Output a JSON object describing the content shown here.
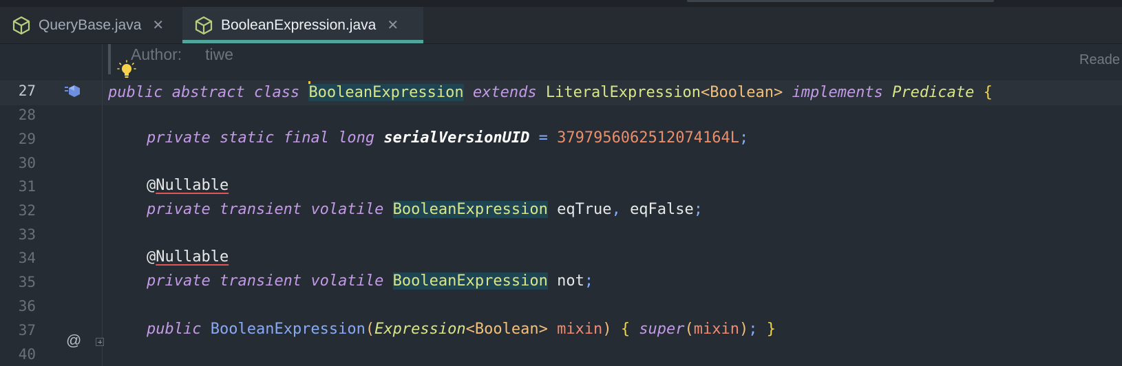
{
  "tabs": [
    {
      "label": "QueryBase.java",
      "active": false,
      "icon": "class-cube-icon"
    },
    {
      "label": "BooleanExpression.java",
      "active": true,
      "icon": "class-cube-icon"
    }
  ],
  "tab_close_glyph": "✕",
  "doc_header": {
    "author_key": "Author:",
    "author_value": "tiwe"
  },
  "reader_mode_label": "Reade",
  "line_numbers": [
    "27",
    "28",
    "29",
    "30",
    "31",
    "32",
    "33",
    "34",
    "35",
    "36",
    "37",
    "40"
  ],
  "code": {
    "l27": {
      "public": "public",
      "abstract": "abstract",
      "class": "class",
      "name": "BooleanExpression",
      "extends": "extends",
      "parent": "LiteralExpression",
      "lt": "<",
      "generic": "Boolean",
      "gt": ">",
      "implements": "implements",
      "iface": "Predicate",
      "brace": "{"
    },
    "l29": {
      "private": "private",
      "static": "static",
      "final": "final",
      "long": "long",
      "field": "serialVersionUID",
      "eq": "=",
      "value": "3797956062512074164L",
      "semi": ";"
    },
    "l31": {
      "at": "@",
      "ann": "Nullable"
    },
    "l32": {
      "private": "private",
      "transient": "transient",
      "volatile": "volatile",
      "type": "BooleanExpression",
      "vars": "eqTrue",
      "comma": ",",
      "vars2": "eqFalse",
      "semi": ";"
    },
    "l34": {
      "at": "@",
      "ann": "Nullable"
    },
    "l35": {
      "private": "private",
      "transient": "transient",
      "volatile": "volatile",
      "type": "BooleanExpression",
      "var": "not",
      "semi": ";"
    },
    "l37": {
      "public": "public",
      "ctor": "BooleanExpression",
      "lp": "(",
      "ptype": "Expression",
      "lt": "<",
      "generic": "Boolean",
      "gt": ">",
      "param": "mixin",
      "rp": ")",
      "lb": "{",
      "super": "super",
      "lp2": "(",
      "arg": "mixin",
      "rp2": ")",
      "semi": ";",
      "rb": "}"
    }
  },
  "gutter": {
    "at_marker": "@"
  },
  "colors": {
    "accent_tab_underline": "#4fa69a",
    "caret": "#f5c542",
    "keyword": "#c39ae6",
    "type": "#d8e58a",
    "number": "#eb8e6b"
  }
}
